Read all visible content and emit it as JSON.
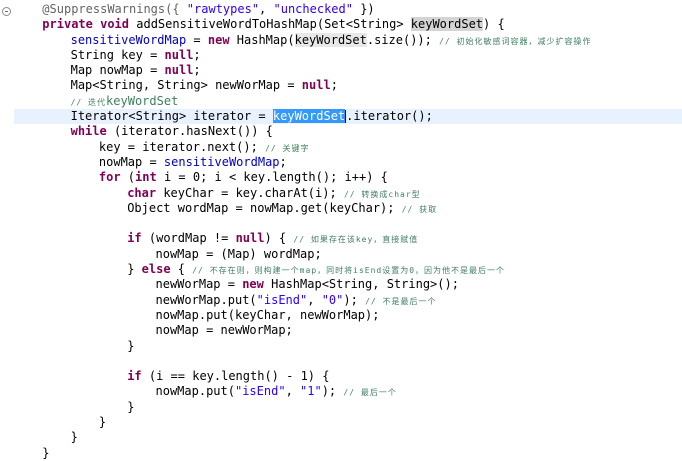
{
  "editor": {
    "lines": [
      {
        "indent": 1,
        "tokens": [
          {
            "t": "@SuppressWarnings({ ",
            "c": "ann"
          },
          {
            "t": "\"rawtypes\"",
            "c": "str"
          },
          {
            "t": ", ",
            "c": ""
          },
          {
            "t": "\"unchecked\"",
            "c": "str"
          },
          {
            "t": " })",
            "c": ""
          }
        ]
      },
      {
        "indent": 1,
        "tokens": [
          {
            "t": "private",
            "c": "kw"
          },
          {
            "t": " ",
            "c": ""
          },
          {
            "t": "void",
            "c": "kw"
          },
          {
            "t": " addSensitiveWordToHashMap(Set<String> ",
            "c": ""
          },
          {
            "t": "keyWordSet",
            "c": "occ"
          },
          {
            "t": ") {",
            "c": ""
          }
        ]
      },
      {
        "indent": 2,
        "tokens": [
          {
            "t": "sensitiveWordMap",
            "c": "field"
          },
          {
            "t": " = ",
            "c": ""
          },
          {
            "t": "new",
            "c": "kw"
          },
          {
            "t": " HashMap(",
            "c": ""
          },
          {
            "t": "keyWordSet",
            "c": "occ-dark"
          },
          {
            "t": ".size()); ",
            "c": ""
          },
          {
            "t": "// 初始化敏感词容器，减少扩容操作",
            "c": "cm cm-cjk"
          }
        ]
      },
      {
        "indent": 2,
        "tokens": [
          {
            "t": "String key = ",
            "c": ""
          },
          {
            "t": "null",
            "c": "kw"
          },
          {
            "t": ";",
            "c": ""
          }
        ]
      },
      {
        "indent": 2,
        "tokens": [
          {
            "t": "Map nowMap = ",
            "c": ""
          },
          {
            "t": "null",
            "c": "kw"
          },
          {
            "t": ";",
            "c": ""
          }
        ]
      },
      {
        "indent": 2,
        "tokens": [
          {
            "t": "Map<String, String> newWorMap = ",
            "c": ""
          },
          {
            "t": "null",
            "c": "kw"
          },
          {
            "t": ";",
            "c": ""
          }
        ]
      },
      {
        "indent": 2,
        "tokens": [
          {
            "t": "// 迭代",
            "c": "cm cm-cjk"
          },
          {
            "t": "keyWordSet",
            "c": "cm"
          }
        ]
      },
      {
        "indent": 2,
        "current": true,
        "tokens": [
          {
            "t": "Iterator<String> iterator = ",
            "c": ""
          },
          {
            "t": "keyWordSet",
            "c": "sel"
          },
          {
            "t": "",
            "c": "caret"
          },
          {
            "t": ".iterator();",
            "c": ""
          }
        ]
      },
      {
        "indent": 2,
        "tokens": [
          {
            "t": "while",
            "c": "kw"
          },
          {
            "t": " (iterator.hasNext()) {",
            "c": ""
          }
        ]
      },
      {
        "indent": 3,
        "tokens": [
          {
            "t": "key = iterator.next(); ",
            "c": ""
          },
          {
            "t": "// 关键字",
            "c": "cm cm-cjk"
          }
        ]
      },
      {
        "indent": 3,
        "tokens": [
          {
            "t": "nowMap = ",
            "c": ""
          },
          {
            "t": "sensitiveWordMap",
            "c": "field"
          },
          {
            "t": ";",
            "c": ""
          }
        ]
      },
      {
        "indent": 3,
        "tokens": [
          {
            "t": "for",
            "c": "kw"
          },
          {
            "t": " (",
            "c": ""
          },
          {
            "t": "int",
            "c": "kw"
          },
          {
            "t": " i = 0; i < key.length(); i++) {",
            "c": ""
          }
        ]
      },
      {
        "indent": 4,
        "tokens": [
          {
            "t": "char",
            "c": "kw"
          },
          {
            "t": " keyChar = key.charAt(i); ",
            "c": ""
          },
          {
            "t": "// 转换成char型",
            "c": "cm cm-cjk"
          }
        ]
      },
      {
        "indent": 4,
        "tokens": [
          {
            "t": "Object wordMap = nowMap.get(keyChar); ",
            "c": ""
          },
          {
            "t": "// 获取",
            "c": "cm cm-cjk"
          }
        ]
      },
      {
        "indent": 0,
        "tokens": []
      },
      {
        "indent": 4,
        "tokens": [
          {
            "t": "if",
            "c": "kw"
          },
          {
            "t": " (wordMap != ",
            "c": ""
          },
          {
            "t": "null",
            "c": "kw"
          },
          {
            "t": ") { ",
            "c": ""
          },
          {
            "t": "// 如果存在该key，直接赋值",
            "c": "cm cm-cjk"
          }
        ]
      },
      {
        "indent": 5,
        "tokens": [
          {
            "t": "nowMap = (Map) wordMap;",
            "c": ""
          }
        ]
      },
      {
        "indent": 4,
        "tokens": [
          {
            "t": "} ",
            "c": ""
          },
          {
            "t": "else",
            "c": "kw"
          },
          {
            "t": " { ",
            "c": ""
          },
          {
            "t": "// 不存在则，则构建一个map，同时将isEnd设置为0，因为他不是最后一个",
            "c": "cm cm-cjk"
          }
        ]
      },
      {
        "indent": 5,
        "tokens": [
          {
            "t": "newWorMap = ",
            "c": ""
          },
          {
            "t": "new",
            "c": "kw"
          },
          {
            "t": " HashMap<String, String>();",
            "c": ""
          }
        ]
      },
      {
        "indent": 5,
        "tokens": [
          {
            "t": "newWorMap.put(",
            "c": ""
          },
          {
            "t": "\"isEnd\"",
            "c": "str"
          },
          {
            "t": ", ",
            "c": ""
          },
          {
            "t": "\"0\"",
            "c": "str"
          },
          {
            "t": "); ",
            "c": ""
          },
          {
            "t": "// 不是最后一个",
            "c": "cm cm-cjk"
          }
        ]
      },
      {
        "indent": 5,
        "tokens": [
          {
            "t": "nowMap.put(keyChar, newWorMap);",
            "c": ""
          }
        ]
      },
      {
        "indent": 5,
        "tokens": [
          {
            "t": "nowMap = newWorMap;",
            "c": ""
          }
        ]
      },
      {
        "indent": 4,
        "tokens": [
          {
            "t": "}",
            "c": ""
          }
        ]
      },
      {
        "indent": 0,
        "tokens": []
      },
      {
        "indent": 4,
        "tokens": [
          {
            "t": "if",
            "c": "kw"
          },
          {
            "t": " (i == key.length() - 1) {",
            "c": ""
          }
        ]
      },
      {
        "indent": 5,
        "tokens": [
          {
            "t": "nowMap.put(",
            "c": ""
          },
          {
            "t": "\"isEnd\"",
            "c": "str"
          },
          {
            "t": ", ",
            "c": ""
          },
          {
            "t": "\"1\"",
            "c": "str"
          },
          {
            "t": "); ",
            "c": ""
          },
          {
            "t": "// 最后一个",
            "c": "cm cm-cjk"
          }
        ]
      },
      {
        "indent": 4,
        "tokens": [
          {
            "t": "}",
            "c": ""
          }
        ]
      },
      {
        "indent": 3,
        "tokens": [
          {
            "t": "}",
            "c": ""
          }
        ]
      },
      {
        "indent": 2,
        "tokens": [
          {
            "t": "}",
            "c": ""
          }
        ]
      },
      {
        "indent": 1,
        "tokens": [
          {
            "t": "}",
            "c": ""
          }
        ]
      }
    ]
  }
}
